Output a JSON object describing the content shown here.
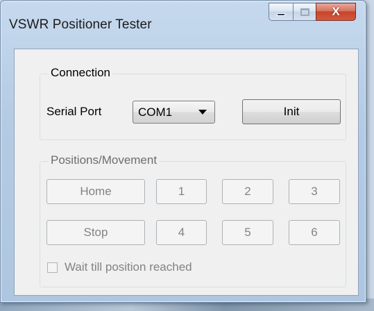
{
  "window": {
    "title": "VSWR Positioner Tester",
    "caption_buttons": {
      "minimize": "minimize",
      "maximize": "maximize",
      "close": "X"
    }
  },
  "connection": {
    "group_label": "Connection",
    "serial_port_label": "Serial Port",
    "serial_port_value": "COM1",
    "init_label": "Init"
  },
  "positions": {
    "group_label": "Positions/Movement",
    "home_label": "Home",
    "stop_label": "Stop",
    "position_buttons": [
      "1",
      "2",
      "3",
      "4",
      "5",
      "6"
    ],
    "wait_checkbox_label": "Wait till position reached",
    "wait_checked": false,
    "enabled": false
  },
  "colors": {
    "close_button": "#c7432a",
    "disabled_text": "#838383"
  }
}
